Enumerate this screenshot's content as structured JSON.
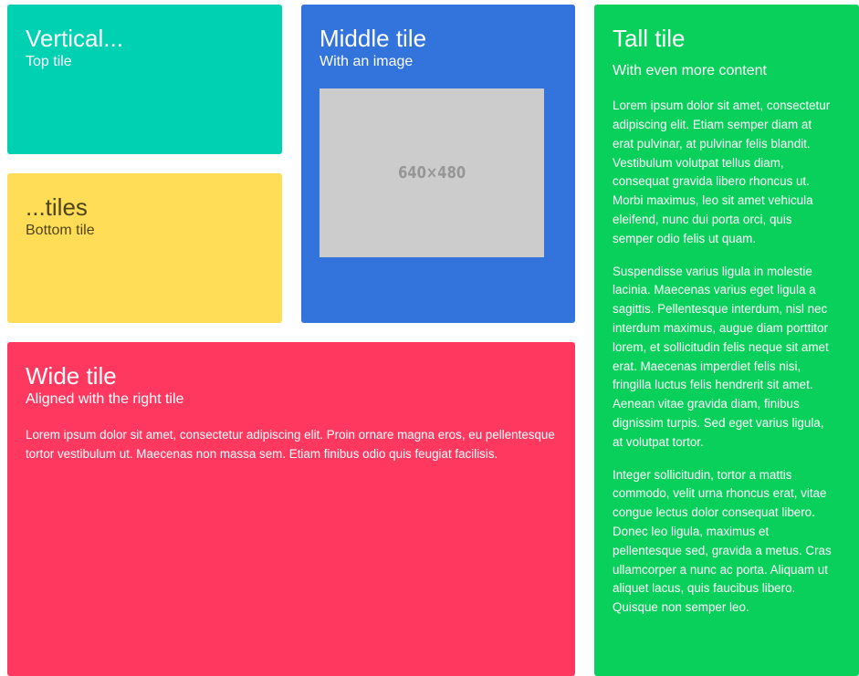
{
  "colors": {
    "top_tile": "#00D1B2",
    "bottom_tile": "#FFDD57",
    "bottom_tile_text": "rgba(0,0,0,0.7)",
    "middle_tile": "#3273DC",
    "wide_tile": "#FF3860",
    "tall_tile": "#08D05B",
    "placeholder_bg": "#CCCCCC",
    "placeholder_text": "#969696"
  },
  "tiles": {
    "top": {
      "title": "Vertical...",
      "subtitle": "Top tile"
    },
    "bottom": {
      "title": "...tiles",
      "subtitle": "Bottom tile"
    },
    "middle": {
      "title": "Middle tile",
      "subtitle": "With an image",
      "image_label": "640×480"
    },
    "wide": {
      "title": "Wide tile",
      "subtitle": "Aligned with the right tile",
      "text": "Lorem ipsum dolor sit amet, consectetur adipiscing elit. Proin ornare magna eros, eu pellentesque tortor vestibulum ut. Maecenas non massa sem. Etiam finibus odio quis feugiat facilisis."
    },
    "tall": {
      "title": "Tall tile",
      "subtitle": "With even more content",
      "paragraphs": [
        "Lorem ipsum dolor sit amet, consectetur adipiscing elit. Etiam semper diam at erat pulvinar, at pulvinar felis blandit. Vestibulum volutpat tellus diam, consequat gravida libero rhoncus ut. Morbi maximus, leo sit amet vehicula eleifend, nunc dui porta orci, quis semper odio felis ut quam.",
        "Suspendisse varius ligula in molestie lacinia. Maecenas varius eget ligula a sagittis. Pellentesque interdum, nisl nec interdum maximus, augue diam porttitor lorem, et sollicitudin felis neque sit amet erat. Maecenas imperdiet felis nisi, fringilla luctus felis hendrerit sit amet. Aenean vitae gravida diam, finibus dignissim turpis. Sed eget varius ligula, at volutpat tortor.",
        "Integer sollicitudin, tortor a mattis commodo, velit urna rhoncus erat, vitae congue lectus dolor consequat libero. Donec leo ligula, maximus et pellentesque sed, gravida a metus. Cras ullamcorper a nunc ac porta. Aliquam ut aliquet lacus, quis faucibus libero. Quisque non semper leo."
      ]
    }
  }
}
